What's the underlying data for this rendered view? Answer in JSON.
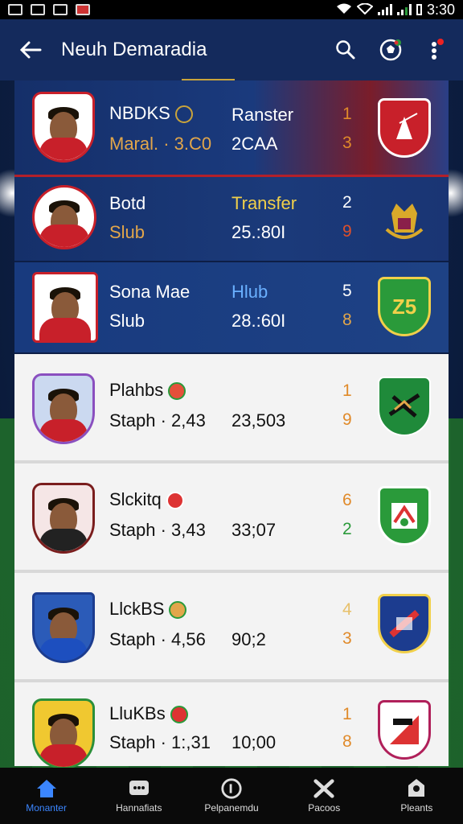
{
  "status_bar": {
    "time": "3:30"
  },
  "app_bar": {
    "title": "Neuh Demaradia",
    "back_icon": "back-arrow-icon",
    "search_icon": "search-icon",
    "ball_icon": "soccer-ball-icon",
    "menu_icon": "more-vert-icon"
  },
  "rows": [
    {
      "name": "NBDKS",
      "sub": "Maral. · 3.C0",
      "col2a": "Ranster",
      "col2b": "2CAA",
      "n1": "1",
      "n2": "3"
    },
    {
      "name": "Botd",
      "sub": "Slub",
      "col2a": "Transfer",
      "col2b": "25.:80I",
      "n1": "2",
      "n2": "9"
    },
    {
      "name": "Sona Mae",
      "sub": "Slub",
      "col2a": "Hlub",
      "col2b": "28.:60I",
      "n1": "5",
      "n2": "8",
      "crest_text": "Z5"
    },
    {
      "name": "Plahbs",
      "sub": "Staph · 2,43",
      "col2b": "23,503",
      "n1": "1",
      "n2": "9"
    },
    {
      "name": "Slckitq",
      "sub": "Staph · 3,43",
      "col2b": "33;07",
      "n1": "6",
      "n2": "2"
    },
    {
      "name": "LlckBS",
      "sub": "Staph · 4,56",
      "col2b": "90;2",
      "n1": "4",
      "n2": "3"
    },
    {
      "name": "LluKBs",
      "sub": "Staph · 1:,31",
      "col2b": "10;00",
      "n1": "1",
      "n2": "8"
    }
  ],
  "bottom_nav": [
    {
      "label": "Monanter",
      "icon": "home-icon"
    },
    {
      "label": "Hannafiats",
      "icon": "chat-icon"
    },
    {
      "label": "Pelpanemdu",
      "icon": "stadium-icon"
    },
    {
      "label": "Pacoos",
      "icon": "tools-icon"
    },
    {
      "label": "Pleants",
      "icon": "profile-icon"
    }
  ],
  "colors": {
    "accent": "#3b86ff",
    "row_dark": "#1b3a7a",
    "row_light": "#f3f3f3",
    "gold": "#c9a43b",
    "orange": "#e08a2a",
    "green": "#2a9a3a"
  }
}
